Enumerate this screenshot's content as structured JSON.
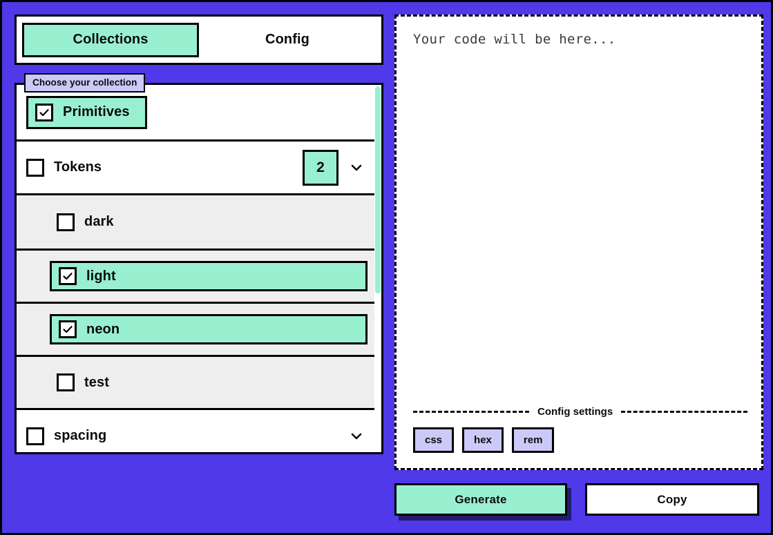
{
  "theme": {
    "background": "#4f39e8",
    "accent_mint": "#99f0d0",
    "accent_lavender": "#cbc9f7",
    "ink": "#000000",
    "subpanel_grey": "#eeeeee",
    "shadow_navy": "#221b6e"
  },
  "tabs": [
    {
      "label": "Collections",
      "active": true
    },
    {
      "label": "Config",
      "active": false
    }
  ],
  "collection_field": {
    "legend": "Choose your collection"
  },
  "collections": [
    {
      "id": "primitives",
      "label": "Primitives",
      "checked": true,
      "selected": true,
      "expandable": false
    },
    {
      "id": "tokens",
      "label": "Tokens",
      "checked": false,
      "selected": false,
      "expandable": true,
      "count": "2",
      "expanded": true,
      "children": [
        {
          "id": "dark",
          "label": "dark",
          "checked": false,
          "selected": false
        },
        {
          "id": "light",
          "label": "light",
          "checked": true,
          "selected": true
        },
        {
          "id": "neon",
          "label": "neon",
          "checked": true,
          "selected": true
        },
        {
          "id": "test",
          "label": "test",
          "checked": false,
          "selected": false
        }
      ]
    },
    {
      "id": "spacing",
      "label": "spacing",
      "checked": false,
      "selected": false,
      "expandable": true,
      "expanded": false
    }
  ],
  "code_panel": {
    "placeholder_text": "Your code will be here...",
    "config_divider_label": "Config settings",
    "config_chips": [
      {
        "label": "css"
      },
      {
        "label": "hex"
      },
      {
        "label": "rem"
      }
    ]
  },
  "actions": {
    "generate_label": "Generate",
    "copy_label": "Copy"
  },
  "icons": {
    "checkmark": "check-icon",
    "chevron": "chevron-down-icon"
  }
}
